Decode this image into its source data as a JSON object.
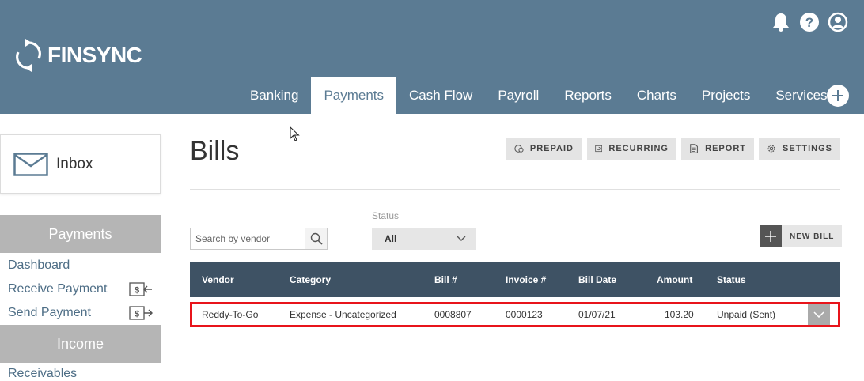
{
  "brand": {
    "name": "FINSYNC"
  },
  "header": {
    "icons": [
      "bell-icon",
      "help-icon",
      "user-icon"
    ],
    "tabs": [
      {
        "label": "Banking",
        "active": false
      },
      {
        "label": "Payments",
        "active": true
      },
      {
        "label": "Cash Flow",
        "active": false
      },
      {
        "label": "Payroll",
        "active": false
      },
      {
        "label": "Reports",
        "active": false
      },
      {
        "label": "Charts",
        "active": false
      },
      {
        "label": "Projects",
        "active": false
      },
      {
        "label": "Services",
        "active": false
      }
    ]
  },
  "sidebar": {
    "inbox_label": "Inbox",
    "payments_header": "Payments",
    "links": [
      {
        "label": "Dashboard",
        "icon": ""
      },
      {
        "label": "Receive Payment",
        "icon": "receive-money-icon"
      },
      {
        "label": "Send Payment",
        "icon": "send-money-icon"
      }
    ],
    "income_header": "Income",
    "partial_link": "Receivables"
  },
  "main": {
    "title": "Bills",
    "actions": [
      {
        "label": "PREPAID",
        "icon": "prepaid-icon"
      },
      {
        "label": "RECURRING",
        "icon": "recurring-icon"
      },
      {
        "label": "REPORT",
        "icon": "report-icon"
      },
      {
        "label": "SETTINGS",
        "icon": "gear-icon"
      }
    ],
    "search": {
      "placeholder": "Search by vendor",
      "value": ""
    },
    "status": {
      "label": "Status",
      "value": "All"
    },
    "new_bill_label": "NEW BILL"
  },
  "table": {
    "columns": [
      "Vendor",
      "Category",
      "Bill #",
      "Invoice #",
      "Bill Date",
      "Amount",
      "Status"
    ],
    "rows": [
      {
        "vendor": "Reddy-To-Go",
        "category": "Expense - Uncategorized",
        "bill_no": "0008807",
        "invoice_no": "0000123",
        "bill_date": "01/07/21",
        "amount": "103.20",
        "status": "Unpaid (Sent)"
      }
    ]
  },
  "colors": {
    "header_bg": "#5b7b93",
    "table_header_bg": "#3e5264",
    "highlight": "#e8141b",
    "sidebar_header": "#b5b5b5"
  }
}
